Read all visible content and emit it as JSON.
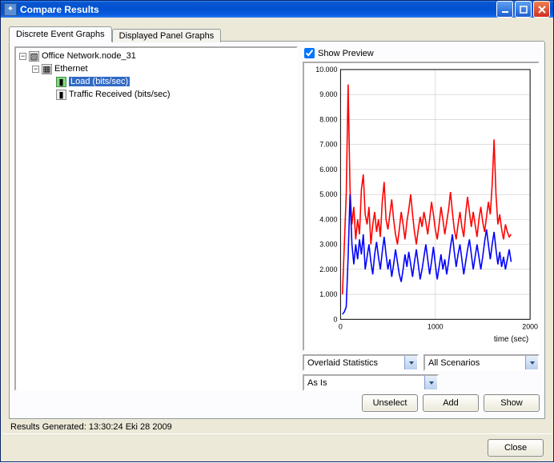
{
  "window": {
    "title": "Compare Results"
  },
  "tabs": {
    "active": "Discrete Event Graphs",
    "inactive": "Displayed Panel Graphs"
  },
  "tree": {
    "root": "Office Network.node_31",
    "group": "Ethernet",
    "items": [
      {
        "label": "Load (bits/sec)",
        "selected": true,
        "checked": true
      },
      {
        "label": "Traffic Received (bits/sec)",
        "selected": false,
        "checked": false
      }
    ]
  },
  "preview": {
    "show_label": "Show Preview",
    "checked": true
  },
  "combos": {
    "overlay": "Overlaid Statistics",
    "scenarios": "All Scenarios",
    "asis": "As Is"
  },
  "buttons": {
    "unselect": "Unselect",
    "add": "Add",
    "show": "Show",
    "close": "Close"
  },
  "status": {
    "text": "Results Generated: 13:30:24 Eki 28 2009"
  },
  "chart_data": {
    "type": "line",
    "xlabel": "time (sec)",
    "ylabel": "",
    "xlim": [
      0,
      2000
    ],
    "ylim": [
      0,
      10.0
    ],
    "xticks": [
      0,
      1000,
      2000
    ],
    "yticks": [
      0,
      1.0,
      2.0,
      3.0,
      4.0,
      5.0,
      6.0,
      7.0,
      8.0,
      9.0,
      10.0
    ],
    "series": [
      {
        "name": "series_red",
        "color": "#ff0000",
        "x": [
          20,
          60,
          80,
          100,
          120,
          140,
          160,
          180,
          200,
          220,
          240,
          260,
          280,
          300,
          320,
          340,
          360,
          380,
          400,
          420,
          440,
          460,
          480,
          500,
          520,
          540,
          560,
          580,
          600,
          620,
          640,
          660,
          680,
          700,
          720,
          740,
          760,
          780,
          800,
          820,
          840,
          860,
          880,
          900,
          920,
          940,
          960,
          980,
          1000,
          1020,
          1040,
          1060,
          1080,
          1100,
          1120,
          1140,
          1160,
          1180,
          1200,
          1220,
          1240,
          1260,
          1280,
          1300,
          1320,
          1340,
          1360,
          1380,
          1400,
          1420,
          1440,
          1460,
          1480,
          1500,
          1520,
          1540,
          1560,
          1580,
          1600,
          1620,
          1640,
          1660,
          1680,
          1700,
          1720,
          1740,
          1760,
          1780,
          1800
        ],
        "values": [
          1.0,
          5.0,
          9.4,
          5.2,
          3.8,
          4.5,
          3.2,
          4.0,
          3.4,
          5.2,
          5.8,
          4.2,
          3.8,
          4.5,
          3.0,
          3.8,
          4.3,
          3.5,
          4.0,
          3.3,
          4.7,
          5.5,
          4.0,
          3.6,
          4.2,
          4.8,
          4.0,
          3.4,
          3.0,
          3.6,
          4.3,
          3.8,
          3.2,
          3.9,
          4.4,
          5.0,
          4.2,
          3.5,
          3.0,
          3.6,
          4.1,
          3.7,
          4.3,
          3.9,
          3.4,
          4.0,
          4.7,
          4.2,
          3.6,
          3.2,
          3.8,
          4.5,
          4.0,
          3.4,
          3.9,
          4.4,
          5.1,
          4.3,
          3.6,
          3.2,
          3.8,
          4.3,
          3.7,
          3.3,
          4.2,
          4.9,
          4.3,
          3.7,
          4.3,
          3.8,
          3.3,
          4.0,
          4.5,
          3.9,
          3.5,
          4.1,
          4.7,
          4.2,
          5.4,
          7.2,
          5.0,
          3.8,
          4.2,
          3.6,
          3.2,
          3.8,
          3.5,
          3.3,
          3.4
        ]
      },
      {
        "name": "series_blue",
        "color": "#0000ff",
        "x": [
          20,
          40,
          60,
          80,
          100,
          120,
          140,
          160,
          180,
          200,
          220,
          240,
          260,
          280,
          300,
          320,
          340,
          360,
          380,
          400,
          420,
          440,
          460,
          480,
          500,
          520,
          540,
          560,
          580,
          600,
          620,
          640,
          660,
          680,
          700,
          720,
          740,
          760,
          780,
          800,
          820,
          840,
          860,
          880,
          900,
          920,
          940,
          960,
          980,
          1000,
          1020,
          1040,
          1060,
          1080,
          1100,
          1120,
          1140,
          1160,
          1180,
          1200,
          1220,
          1240,
          1260,
          1280,
          1300,
          1320,
          1340,
          1360,
          1380,
          1400,
          1420,
          1440,
          1460,
          1480,
          1500,
          1520,
          1540,
          1560,
          1580,
          1600,
          1620,
          1640,
          1660,
          1680,
          1700,
          1720,
          1740,
          1760,
          1780,
          1800
        ],
        "values": [
          0.2,
          0.3,
          0.5,
          2.5,
          5.0,
          3.0,
          2.2,
          3.0,
          2.4,
          3.2,
          2.6,
          3.4,
          2.0,
          2.5,
          3.0,
          2.3,
          1.8,
          2.6,
          3.1,
          2.5,
          2.0,
          2.7,
          3.3,
          2.6,
          2.0,
          2.4,
          1.7,
          2.2,
          2.8,
          2.3,
          1.8,
          1.5,
          2.0,
          2.6,
          2.1,
          2.7,
          2.2,
          1.7,
          2.3,
          2.8,
          2.2,
          1.6,
          2.0,
          2.5,
          3.0,
          2.4,
          1.8,
          2.3,
          2.9,
          2.2,
          1.6,
          2.1,
          2.6,
          2.0,
          2.4,
          1.8,
          2.3,
          2.9,
          3.4,
          2.7,
          2.1,
          2.6,
          3.0,
          2.4,
          1.8,
          2.3,
          2.8,
          3.2,
          2.6,
          2.0,
          2.5,
          3.0,
          2.5,
          2.0,
          2.5,
          3.1,
          3.6,
          3.0,
          2.4,
          3.0,
          3.5,
          2.8,
          2.2,
          2.7,
          2.1,
          2.5,
          2.0,
          2.4,
          2.8,
          2.3
        ]
      }
    ]
  }
}
